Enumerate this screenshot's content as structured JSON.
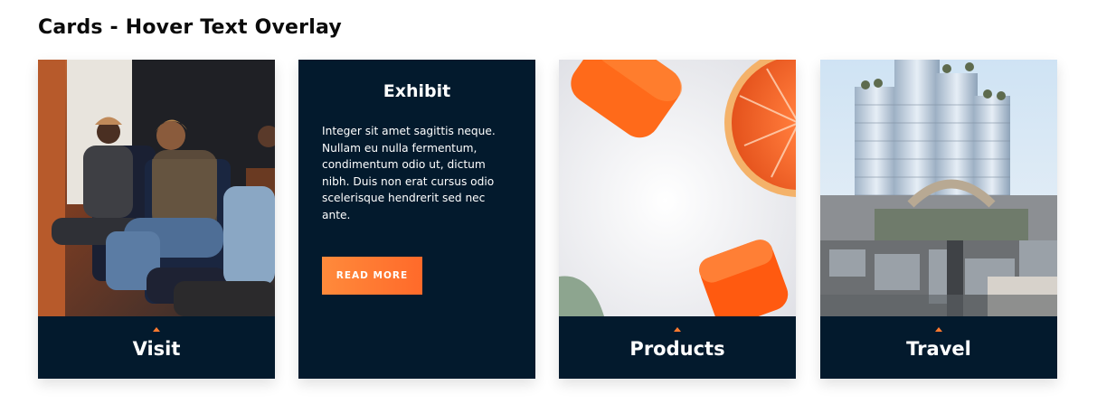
{
  "page": {
    "title": "Cards - Hover Text Overlay"
  },
  "colors": {
    "card_background": "#031a2d",
    "accent": "#ff7a2f",
    "button_gradient_start": "#ff8a3b",
    "button_gradient_end": "#ff6a2a"
  },
  "cards": [
    {
      "title": "Visit",
      "image": "panel-discussion-photo",
      "icon": "caret-up-icon"
    },
    {
      "title": "Exhibit",
      "body": "Integer sit amet sagittis neque. Nullam eu nulla fermentum, condimentum odio ut, dictum nibh. Duis non erat cursus odio scelerisque hendrerit sed nec ante.",
      "button_label": "READ MORE"
    },
    {
      "title": "Products",
      "image": "orange-products-photo",
      "icon": "caret-up-icon"
    },
    {
      "title": "Travel",
      "image": "city-buildings-photo",
      "icon": "caret-up-icon"
    }
  ]
}
